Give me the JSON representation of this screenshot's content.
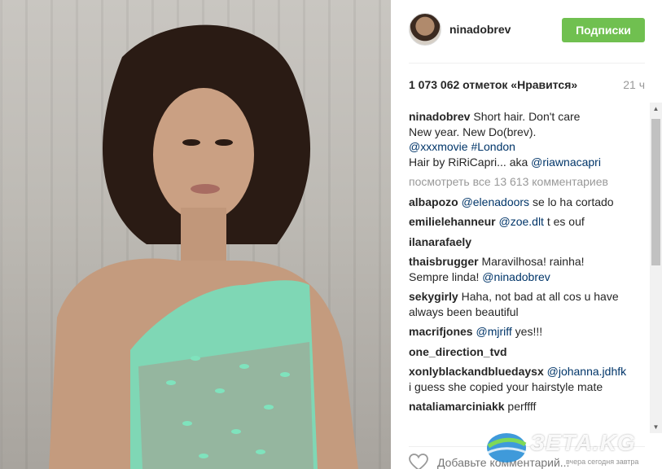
{
  "post": {
    "username": "ninadobrev",
    "follow_label": "Подписки",
    "likes": "1 073 062 отметок «Нравится»",
    "time": "21 ч",
    "caption": {
      "user": "ninadobrev",
      "line1": "Short hair. Don't care",
      "line2": "New year. New Do(brev).",
      "tags": "@xxxmovie #London",
      "line4_text": "Hair by RiRiCapri... aka ",
      "line4_link": "@riawnacapri"
    },
    "view_all": "посмотреть все 13 613 комментариев",
    "add_comment_placeholder": "Добавьте комментарий..."
  },
  "comments": [
    {
      "user": "albapozo",
      "mention": "@elenadoors",
      "text": " se lo ha cortado"
    },
    {
      "user": "emilielehanneur",
      "mention": "@zoe.dlt",
      "text": " t es ouf"
    },
    {
      "user": "ilanarafaely",
      "mention": "",
      "text": ""
    },
    {
      "user": "thaisbrugger",
      "mention": "",
      "text": "Maravilhosa! rainha! Sempre linda! ",
      "mention2": "@ninadobrev"
    },
    {
      "user": "sekygirly",
      "mention": "",
      "text": "Haha, not bad at all cos u have always been beautiful"
    },
    {
      "user": "macrifjones",
      "mention": "@mjriff",
      "text": " yes!!!"
    },
    {
      "user": "one_direction_tvd",
      "mention": "",
      "text": ""
    },
    {
      "user": "xonlyblackandbluedaysx",
      "mention": "@johanna.jdhfk",
      "text": " i guess she copied your hairstyle mate"
    },
    {
      "user": "nataliamarciniakk",
      "mention": "",
      "text": "perffff"
    }
  ],
  "watermark": {
    "logo_text": "ЗЕТА.KG",
    "tagline": "вчера сегодня завтра"
  },
  "colors": {
    "follow_button": "#70c050",
    "link": "#003569",
    "muted": "#999999"
  }
}
